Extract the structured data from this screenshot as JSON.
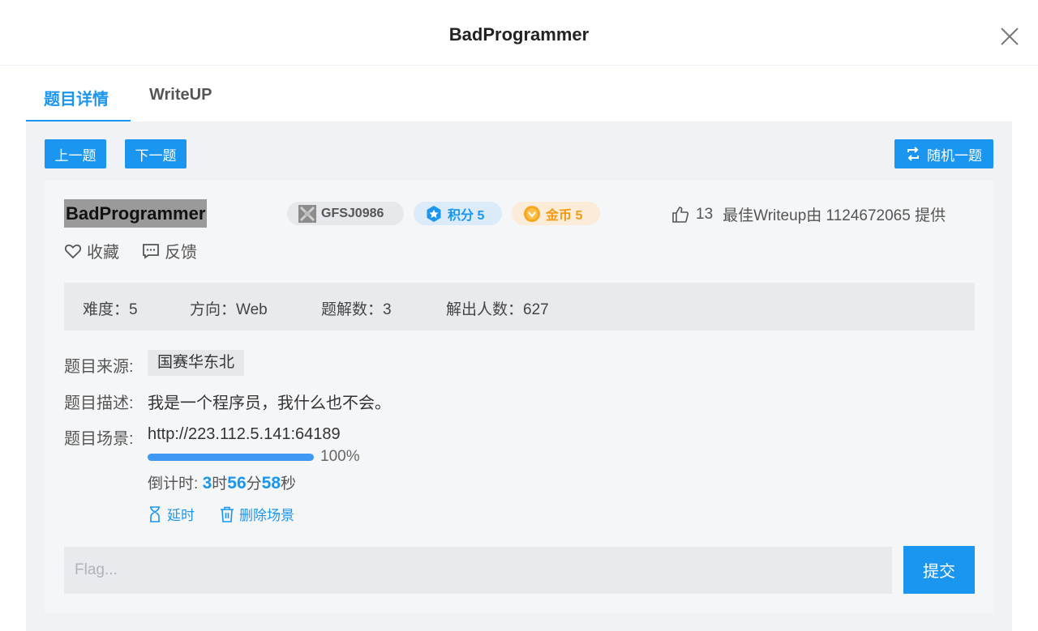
{
  "dialog": {
    "title": "BadProgrammer",
    "close_icon": "close-icon"
  },
  "tabs": [
    {
      "label": "题目详情",
      "active": true
    },
    {
      "label": "WriteUP",
      "active": false
    }
  ],
  "nav": {
    "prev_label": "上一题",
    "next_label": "下一题",
    "random_label": "随机一题",
    "random_icon": "shuffle-icon"
  },
  "problem": {
    "name": "BadProgrammer",
    "id_badge": "GFSJ0986",
    "score_badge": "积分 5",
    "coin_badge": "金币 5",
    "likes": "13",
    "best_writeup": "最佳Writeup由 1124672065 提供",
    "favorite_label": "收藏",
    "feedback_label": "反馈"
  },
  "stats": {
    "difficulty": "难度：5",
    "direction": "方向：Web",
    "writeups": "题解数：3",
    "solved": "解出人数：627"
  },
  "fields": {
    "source_label": "题目来源:",
    "source_value": "国赛华东北",
    "desc_label": "题目描述:",
    "desc_value": "我是一个程序员，我什么也不会。",
    "scene_label": "题目场景:",
    "scene_url": "http://223.112.5.141:64189"
  },
  "scene": {
    "progress": 1.0,
    "progress_text": "100%",
    "countdown_prefix": "倒计时: ",
    "hours": "3",
    "hours_unit": "时",
    "minutes": "56",
    "minutes_unit": "分",
    "seconds": "58",
    "seconds_unit": "秒",
    "delay_label": "延时",
    "delete_label": "删除场景"
  },
  "flag": {
    "placeholder": "Flag...",
    "value": "",
    "submit_label": "提交"
  },
  "colors": {
    "accent": "#1a96f0",
    "coin": "#f29a12"
  }
}
